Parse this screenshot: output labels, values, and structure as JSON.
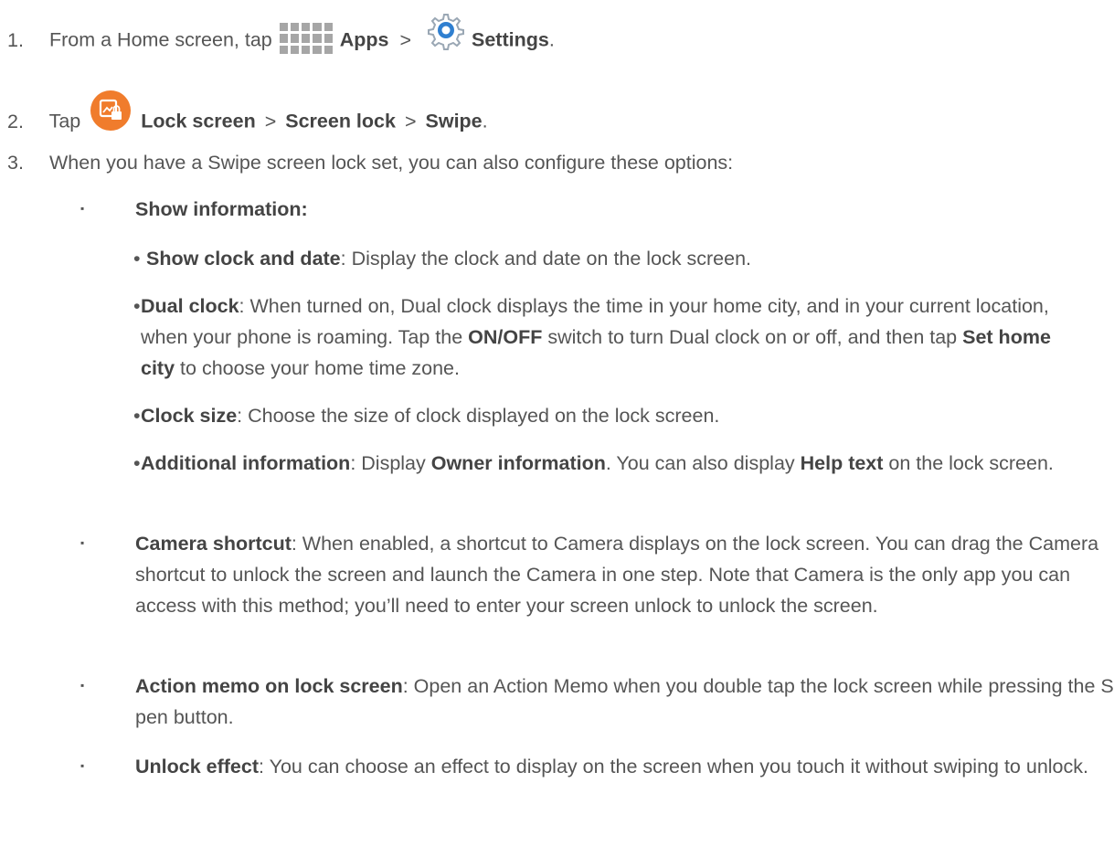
{
  "steps": [
    {
      "num": "1.",
      "parts": {
        "a": "From a Home screen, tap",
        "b": "Apps",
        "c": ">",
        "d": "Settings",
        "e": "."
      },
      "icons": [
        "apps-grid-icon",
        "settings-gear-icon"
      ]
    },
    {
      "num": "2.",
      "parts": {
        "a": "Tap",
        "b": "Lock screen",
        "c": ">",
        "d": "Screen lock",
        "e": ">",
        "f": "Swipe",
        "g": "."
      },
      "icons": [
        "lock-screen-icon"
      ],
      "colors": {
        "lock_icon": "#f07c2c"
      }
    },
    {
      "num": "3.",
      "text": "When you have a Swipe screen lock set, you can also configure these options:"
    }
  ],
  "options": {
    "show_information": {
      "title": "Show information:",
      "items": [
        {
          "title": "Show clock and date",
          "text": ": Display the clock and date on the lock screen."
        },
        {
          "title": "Dual clock",
          "text1": ": When turned on, Dual clock displays the time in your home city, and in your current location, when your phone is roaming. Tap the ",
          "bold1": "ON/OFF",
          "text2": " switch to turn Dual clock on or off, and then tap ",
          "bold2": "Set home city",
          "text3": " to choose your home time zone."
        },
        {
          "title": "Clock size",
          "text": ": Choose the size of clock displayed on the lock screen."
        },
        {
          "title": "Additional information",
          "text1": ": Display ",
          "bold1": "Owner information",
          "text2": ". You can also display ",
          "bold2": "Help text",
          "text3": " on the lock screen."
        }
      ]
    },
    "camera_shortcut": {
      "title": "Camera shortcut",
      "text": ": When enabled, a shortcut to Camera displays on the lock screen. You can drag the Camera shortcut to unlock the screen and launch the Camera in one step. Note that Camera is the only app you can access with this method; you’ll need to enter your screen unlock to unlock the screen."
    },
    "action_memo": {
      "title": "Action memo on lock screen",
      "text": ": Open an Action Memo when you double tap the lock screen while pressing the S pen button."
    },
    "unlock_effect": {
      "title": "Unlock effect",
      "text": ": You can choose an effect to display on the screen when you touch it without swiping to unlock."
    }
  },
  "bullets": {
    "square": "▪",
    "dot": "•"
  }
}
